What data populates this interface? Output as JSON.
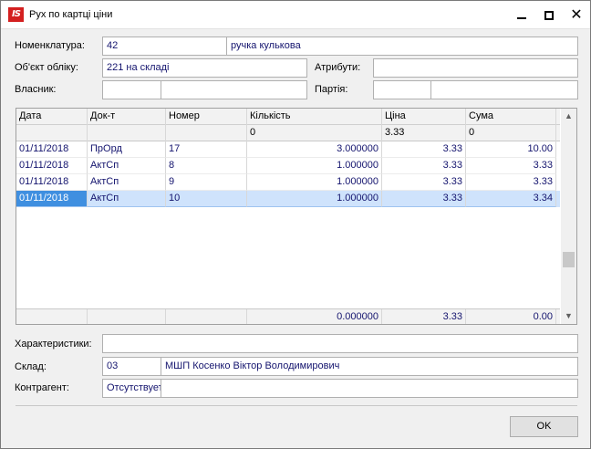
{
  "window": {
    "title": "Рух по картці ціни",
    "icon_text": "IS"
  },
  "form": {
    "nomenclature_label": "Номенклатура:",
    "nomenclature_code": "42",
    "nomenclature_name": "ручка кулькова",
    "account_object_label": "Об'єкт обліку:",
    "account_object_value": "221 на складі",
    "attributes_label": "Атрибути:",
    "attributes_value": "",
    "owner_label": "Власник:",
    "owner_code": "",
    "owner_name": "",
    "batch_label": "Партія:",
    "batch_code": "",
    "batch_name": "",
    "characteristics_label": "Характеристики:",
    "characteristics_value": "",
    "warehouse_label": "Склад:",
    "warehouse_code": "03",
    "warehouse_name": "МШП Косенко Віктор Володимирович",
    "counterparty_label": "Контрагент:",
    "counterparty_code": "Отсутствует",
    "counterparty_name": ""
  },
  "grid": {
    "columns": [
      "Дата",
      "Док-т",
      "Номер",
      "Кількість",
      "Ціна",
      "Сума"
    ],
    "opening": {
      "date": "",
      "doc": "",
      "number": "",
      "qty": "0",
      "price": "3.33",
      "sum": "0"
    },
    "rows": [
      {
        "date": "01/11/2018",
        "doc": "ПрОрд",
        "number": "17",
        "qty": "3.000000",
        "price": "3.33",
        "sum": "10.00"
      },
      {
        "date": "01/11/2018",
        "doc": "АктСп",
        "number": "8",
        "qty": "1.000000",
        "price": "3.33",
        "sum": "3.33"
      },
      {
        "date": "01/11/2018",
        "doc": "АктСп",
        "number": "9",
        "qty": "1.000000",
        "price": "3.33",
        "sum": "3.33"
      },
      {
        "date": "01/11/2018",
        "doc": "АктСп",
        "number": "10",
        "qty": "1.000000",
        "price": "3.33",
        "sum": "3.34"
      }
    ],
    "selected_row": 3,
    "totals": {
      "qty": "0.000000",
      "price": "3.33",
      "sum": "0.00"
    }
  },
  "buttons": {
    "ok": "OK"
  }
}
